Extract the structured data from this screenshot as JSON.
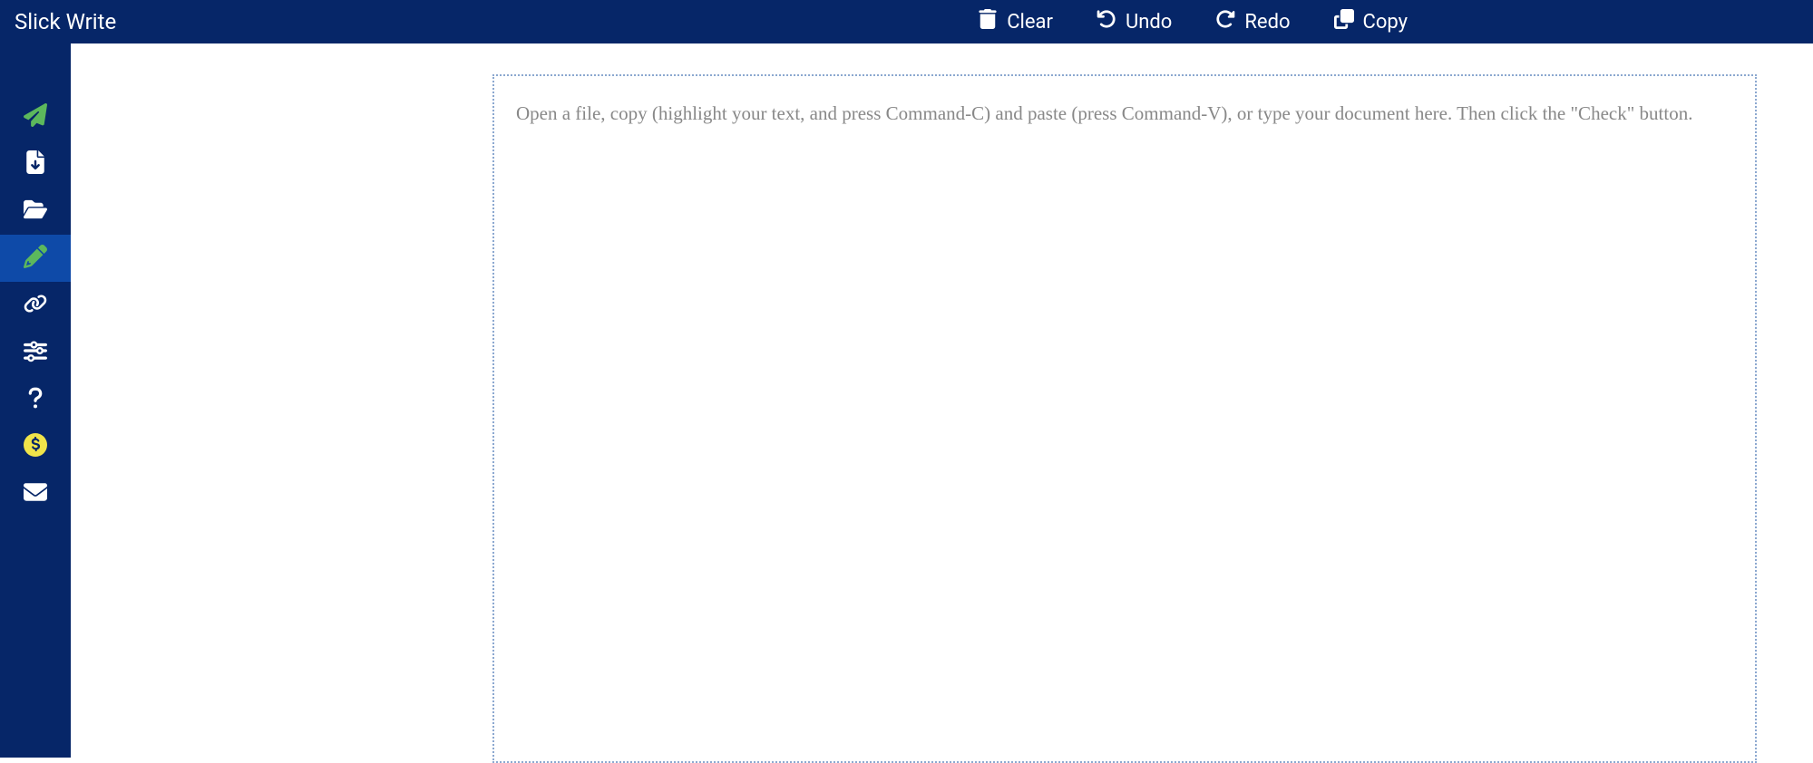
{
  "header": {
    "brand": "Slick Write",
    "toolbar": {
      "clear": "Clear",
      "undo": "Undo",
      "redo": "Redo",
      "copy": "Copy"
    }
  },
  "sidebar": {
    "items": [
      {
        "name": "check",
        "icon": "paper-plane",
        "color": "green"
      },
      {
        "name": "file",
        "icon": "file-download",
        "color": "white"
      },
      {
        "name": "open",
        "icon": "folder-open",
        "color": "white"
      },
      {
        "name": "edit",
        "icon": "pencil",
        "color": "green",
        "active": true
      },
      {
        "name": "link",
        "icon": "link",
        "color": "white"
      },
      {
        "name": "settings",
        "icon": "sliders",
        "color": "white"
      },
      {
        "name": "help",
        "icon": "question",
        "color": "white"
      },
      {
        "name": "donate",
        "icon": "dollar-circle",
        "color": "yellow"
      },
      {
        "name": "contact",
        "icon": "envelope",
        "color": "white"
      }
    ]
  },
  "editor": {
    "placeholder": "Open a file, copy (highlight your text, and press Command-C) and paste (press Command-V), or type your document here. Then click the \"Check\" button."
  }
}
